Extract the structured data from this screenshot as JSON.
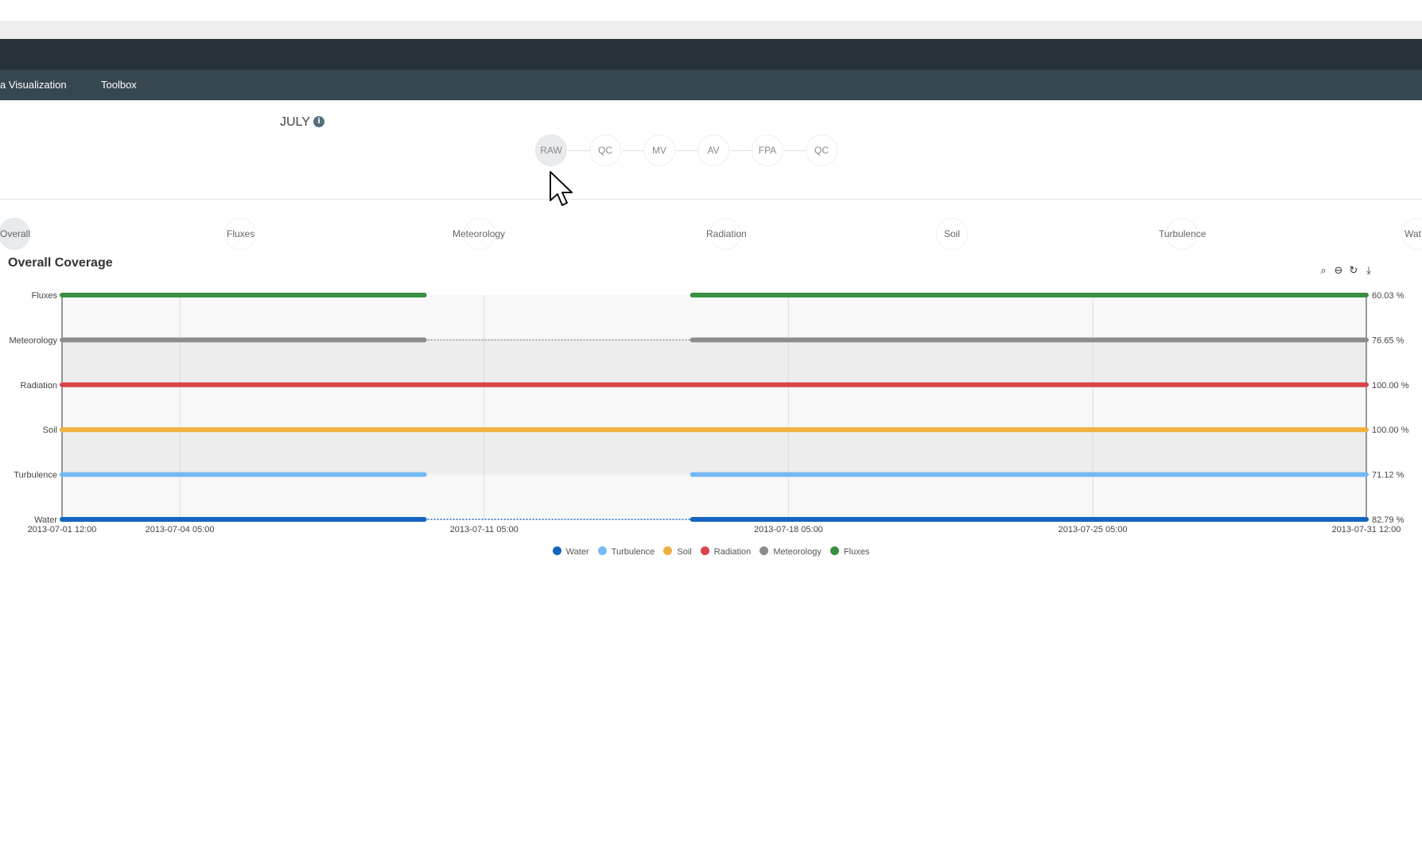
{
  "nav": {
    "items": [
      "a Visualization",
      "Toolbox"
    ]
  },
  "month": {
    "label": "JULY",
    "info_icon": "info-icon"
  },
  "steps": [
    "RAW",
    "QC",
    "MV",
    "AV",
    "FPA",
    "QC"
  ],
  "active_step": "RAW",
  "categories": [
    "Overall",
    "Fluxes",
    "Meteorology",
    "Radiation",
    "Soil",
    "Turbulence",
    "Wat"
  ],
  "active_category": "Overall",
  "toolbar_icons": [
    "zoom-in-icon",
    "zoom-out-icon",
    "reset-icon",
    "download-icon"
  ],
  "chart_data": {
    "type": "line",
    "title": "Overall Coverage",
    "x_ticks": [
      "2013-07-01 12:00",
      "2013-07-04 05:00",
      "2013-07-11 05:00",
      "2013-07-18 05:00",
      "2013-07-25 05:00",
      "2013-07-31 12:00"
    ],
    "xlim": [
      "2013-07-01 12:00",
      "2013-07-31 12:00"
    ],
    "y_categories": [
      "Fluxes",
      "Meteorology",
      "Radiation",
      "Soil",
      "Turbulence",
      "Water"
    ],
    "coverage_labels": [
      "60.03 %",
      "76.65 %",
      "100.00 %",
      "100.00 %",
      "71.12 %",
      "82.79 %"
    ],
    "series": [
      {
        "name": "Water",
        "color": "#1565c0",
        "level": "Water",
        "segments": [
          [
            "2013-07-01 12:00",
            "2013-07-09 20:00"
          ],
          [
            "2013-07-16 00:00",
            "2013-07-31 12:00"
          ]
        ],
        "dashed_gap": true
      },
      {
        "name": "Turbulence",
        "color": "#74b9f5",
        "level": "Turbulence",
        "segments": [
          [
            "2013-07-01 12:00",
            "2013-07-09 20:00"
          ],
          [
            "2013-07-16 00:00",
            "2013-07-31 12:00"
          ]
        ],
        "dashed_gap": false
      },
      {
        "name": "Soil",
        "color": "#f0b040",
        "level": "Soil",
        "segments": [
          [
            "2013-07-01 12:00",
            "2013-07-31 12:00"
          ]
        ],
        "dashed_gap": false
      },
      {
        "name": "Radiation",
        "color": "#d9434a",
        "level": "Radiation",
        "segments": [
          [
            "2013-07-01 12:00",
            "2013-07-31 12:00"
          ]
        ],
        "dashed_gap": false
      },
      {
        "name": "Meteorology",
        "color": "#8c8c8c",
        "level": "Meteorology",
        "segments": [
          [
            "2013-07-01 12:00",
            "2013-07-09 20:00"
          ],
          [
            "2013-07-16 00:00",
            "2013-07-31 12:00"
          ]
        ],
        "dashed_gap": true
      },
      {
        "name": "Fluxes",
        "color": "#3a8e42",
        "level": "Fluxes",
        "segments": [
          [
            "2013-07-01 12:00",
            "2013-07-09 20:00"
          ],
          [
            "2013-07-16 00:00",
            "2013-07-31 12:00"
          ]
        ],
        "dashed_gap": false
      }
    ],
    "legend": [
      "Water",
      "Turbulence",
      "Soil",
      "Radiation",
      "Meteorology",
      "Fluxes"
    ],
    "legend_position": "bottom-center",
    "grid": true
  }
}
